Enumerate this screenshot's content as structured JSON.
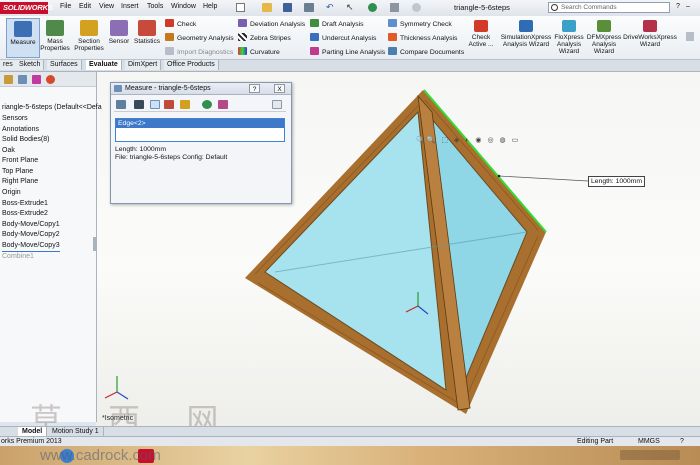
{
  "app": {
    "logo_text": "SOLIDWORKS",
    "document_title": "triangle-5-6steps",
    "menus": [
      "File",
      "Edit",
      "View",
      "Insert",
      "Tools",
      "Window",
      "Help"
    ],
    "search_placeholder": "Search Commands"
  },
  "ribbon": {
    "big_buttons": [
      "Measure",
      "Mass Properties",
      "Section Properties",
      "Sensor",
      "Statistics"
    ],
    "col1": [
      "Check",
      "Geometry Analysis",
      "Import Diagnostics"
    ],
    "col2": [
      "Deviation Analysis",
      "Zebra Stripes",
      "Curvature"
    ],
    "col3": [
      "Draft Analysis",
      "Undercut Analysis",
      "Parting Line Analysis"
    ],
    "col4": [
      "Symmetry Check",
      "Thickness Analysis",
      "Compare Documents"
    ],
    "check_active": "Check Active ...",
    "wizards": [
      "SimulationXpress Analysis Wizard",
      "FloXpress Analysis Wizard",
      "DFMXpress Analysis Wizard",
      "DriveWorksXpress Wizard"
    ]
  },
  "tabs": [
    "res",
    "Sketch",
    "Surfaces",
    "Evaluate",
    "DimXpert",
    "Office Products"
  ],
  "active_tab": "Evaluate",
  "feature_tree": {
    "root": "riangle-5-6steps  (Default<<Defa",
    "items": [
      "Sensors",
      "Annotations",
      "Solid Bodies(8)",
      "Oak",
      "Front Plane",
      "Top Plane",
      "Right Plane",
      "Origin",
      "Boss-Extrude1",
      "Boss-Extrude2",
      "Body-Move/Copy1",
      "Body-Move/Copy2",
      "Body-Move/Copy3"
    ],
    "rolled_back": "Combine1"
  },
  "measure_dialog": {
    "title": "Measure - triangle-5-6steps",
    "help_btn": "?",
    "close_btn": "X",
    "selection": "Edge<2>",
    "length_line": "Length: 1000mm",
    "file_line": "File: triangle-5-6steps Config: Default"
  },
  "viewport": {
    "callout": "Length: 1000mm",
    "view_label": "*Isometric"
  },
  "bottom_tabs": [
    "Model",
    "Motion Study 1"
  ],
  "status": {
    "left": "orks Premium 2013",
    "mode": "Editing Part",
    "units": "MMGS",
    "help": "?"
  },
  "watermark": {
    "text": "草 西 网",
    "url": "www.cadrock.com"
  },
  "colors": {
    "accent": "#3e78c9",
    "wood": "#b07a35",
    "glass": "#9fe0ea",
    "edge_highlight": "#33dd33"
  }
}
